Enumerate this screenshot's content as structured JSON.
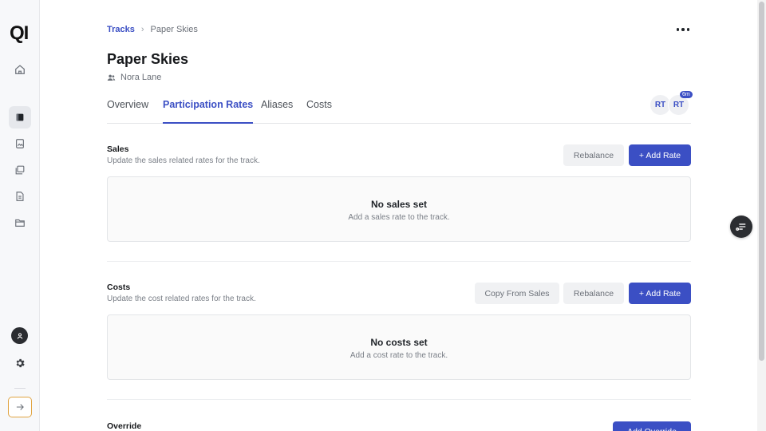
{
  "app": {
    "logo_text": "QI"
  },
  "sidebar": {
    "items": [
      {
        "icon": "home-icon"
      },
      {
        "icon": "tracks-icon",
        "active": true
      },
      {
        "icon": "image-file-icon"
      },
      {
        "icon": "layers-icon"
      },
      {
        "icon": "document-icon"
      },
      {
        "icon": "folder-icon"
      }
    ],
    "bottom": [
      {
        "icon": "user-icon"
      },
      {
        "icon": "gear-icon"
      },
      {
        "icon": "arrow-right-icon"
      }
    ]
  },
  "breadcrumb": {
    "parent": "Tracks",
    "separator": "›",
    "current": "Paper Skies"
  },
  "header": {
    "title": "Paper Skies",
    "owner": "Nora Lane"
  },
  "tabs": [
    {
      "label": "Overview",
      "active": false
    },
    {
      "label": "Participation Rates",
      "active": true
    },
    {
      "label": "Aliases",
      "active": false
    },
    {
      "label": "Costs",
      "active": false
    }
  ],
  "presence": {
    "avatars": [
      "RT",
      "RT"
    ],
    "badge": "6m"
  },
  "sections": {
    "sales": {
      "title": "Sales",
      "subtitle": "Update the sales related rates for the track.",
      "rebalance_label": "Rebalance",
      "add_label": "+ Add Rate",
      "empty_title": "No sales set",
      "empty_sub": "Add a sales rate to the track."
    },
    "costs": {
      "title": "Costs",
      "subtitle": "Update the cost related rates for the track.",
      "copy_label": "Copy From Sales",
      "rebalance_label": "Rebalance",
      "add_label": "+ Add Rate",
      "empty_title": "No costs set",
      "empty_sub": "Add a cost rate to the track."
    },
    "override": {
      "title": "Override",
      "add_label": "Add Override"
    }
  },
  "colors": {
    "accent": "#3b4fc4",
    "focus_border": "#e0a340",
    "dark": "#2b2d31"
  }
}
